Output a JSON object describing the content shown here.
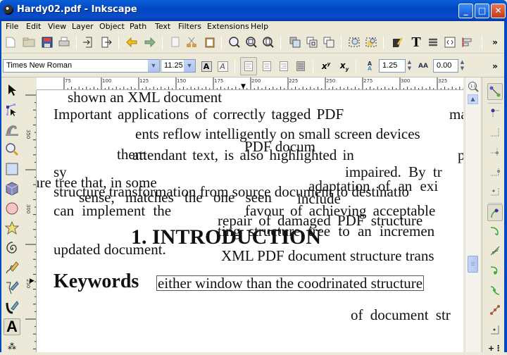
{
  "window": {
    "title": "Hardy02.pdf - Inkscape",
    "controls": {
      "minimize": "_",
      "maximize": "□",
      "close": "✕"
    }
  },
  "menu": [
    "File",
    "Edit",
    "View",
    "Layer",
    "Object",
    "Path",
    "Text",
    "Filters",
    "Extensions",
    "Help"
  ],
  "commands_toolbar": {
    "icons": [
      "new-document-icon",
      "open-icon",
      "save-icon",
      "print-icon",
      "import-icon",
      "export-icon",
      "undo-icon",
      "redo-icon",
      "copy-icon",
      "cut-icon",
      "paste-icon",
      "zoom-selection-icon",
      "zoom-drawing-icon",
      "zoom-page-icon",
      "duplicate-icon",
      "clone-icon",
      "unlink-clone-icon",
      "group-icon",
      "ungroup-icon",
      "fill-stroke-icon",
      "text-font-icon",
      "layers-icon",
      "xml-editor-icon",
      "align-distribute-icon"
    ],
    "overflow": "»"
  },
  "text_toolbar": {
    "font_family": "Times New Roman",
    "font_size": "11.25",
    "line_spacing": "1.25",
    "letter_spacing": "0.00",
    "overflow": "»"
  },
  "rulers": {
    "horizontal": [
      "75",
      "100",
      "125",
      "150",
      "175",
      "200",
      "225",
      "250",
      "275",
      "300",
      "325"
    ],
    "vertical": [
      "350",
      "300",
      "250"
    ]
  },
  "tools": [
    "selector-tool",
    "node-tool",
    "tweak-tool",
    "zoom-tool",
    "rectangle-tool",
    "3d-box-tool",
    "ellipse-tool",
    "star-tool",
    "spiral-tool",
    "pencil-tool",
    "pen-tool",
    "calligraphy-tool",
    "text-tool",
    "spray-tool"
  ],
  "active_tool": "text-tool",
  "canvas_text": {
    "l1": "shown an XML document",
    "l2a": "Important applications of correctly tagged PDF",
    "l2b": "ma",
    "l3": "ents reflow intelligently on small screen devices",
    "l4a": "PDF docum",
    "l4b": "them",
    "l4c": "attendant text, is also highlighted in",
    "l4d": "p",
    "l5a": "sy",
    "l5b": "impaired. By tr",
    "l6a": "ure tree that, in some",
    "l6b": "adaptation of an exi",
    "l7a": "structure transformation from source document to destinatio",
    "l7b": "sense, matches the one seen",
    "l7c": "include",
    "l8a": "can implement the",
    "l8b": "favour of achieving acceptable",
    "l9": "repair of damaged PDF structure",
    "l10": "ting structure tree to an incremen",
    "heading": "1. INTRODUCTION",
    "l11": "updated document.",
    "l12": "XML PDF document structure trans",
    "keywords": "Keywords",
    "selected_text": "either window than the coodrinated structure",
    "l13": "of document str"
  },
  "snap_toolbar": [
    "enable-snapping",
    "snap-bbox",
    "snap-bbox-edge",
    "snap-bbox-corner",
    "snap-bbox-midpoint",
    "snap-bbox-center",
    "snap-nodes",
    "snap-paths",
    "snap-path-intersections",
    "snap-cusp-nodes",
    "snap-smooth-nodes",
    "snap-line-midpoints",
    "snap-object-center",
    "snap-rotation-center"
  ],
  "colors": {
    "titlebar": "#0047c2",
    "chrome": "#ece9d8",
    "canvas": "#ffffff"
  }
}
